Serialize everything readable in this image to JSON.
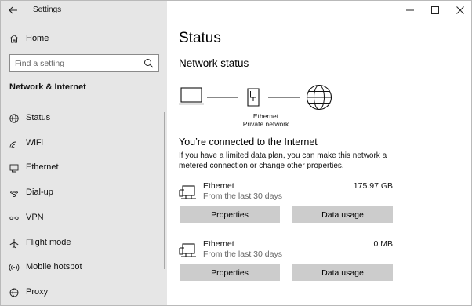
{
  "window": {
    "title": "Settings"
  },
  "sidebar": {
    "home_label": "Home",
    "search": {
      "placeholder": "Find a setting",
      "value": ""
    },
    "section_heading": "Network & Internet",
    "items": [
      {
        "label": "Status",
        "icon": "globe-status-icon",
        "active": true
      },
      {
        "label": "WiFi",
        "icon": "wifi-icon",
        "active": false
      },
      {
        "label": "Ethernet",
        "icon": "ethernet-icon",
        "active": false
      },
      {
        "label": "Dial-up",
        "icon": "dial-up-icon",
        "active": false
      },
      {
        "label": "VPN",
        "icon": "vpn-icon",
        "active": false
      },
      {
        "label": "Flight mode",
        "icon": "airplane-icon",
        "active": false
      },
      {
        "label": "Mobile hotspot",
        "icon": "hotspot-icon",
        "active": false
      },
      {
        "label": "Proxy",
        "icon": "proxy-icon",
        "active": false
      }
    ]
  },
  "main": {
    "title": "Status",
    "network_status_heading": "Network status",
    "diagram": {
      "adapter_name": "Ethernet",
      "profile": "Private network"
    },
    "connected_heading": "You’re connected to the Internet",
    "description": "If you have a limited data plan, you can make this network a metered connection or change other properties.",
    "adapters": [
      {
        "name": "Ethernet",
        "period": "From the last 30 days",
        "usage": "175.97 GB",
        "properties_label": "Properties",
        "data_usage_label": "Data usage"
      },
      {
        "name": "Ethernet",
        "period": "From the last 30 days",
        "usage": "0 MB",
        "properties_label": "Properties",
        "data_usage_label": "Data usage"
      }
    ]
  },
  "colors": {
    "sidebar_bg": "#e6e6e6",
    "button_bg": "#cccccc",
    "accent": "#0078d7"
  }
}
